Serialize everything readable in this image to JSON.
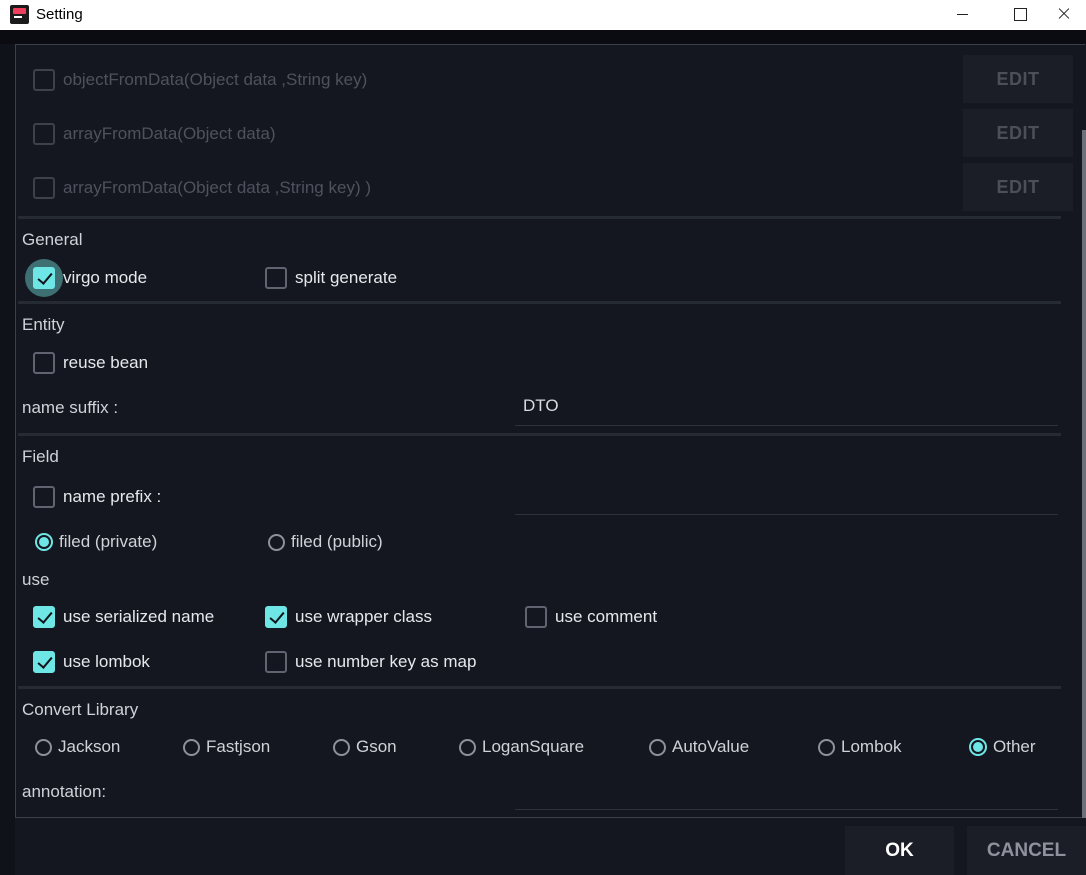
{
  "window": {
    "title": "Setting"
  },
  "methods": [
    {
      "label": "objectFromData(Object data ,String key)",
      "checked": false,
      "button": "EDIT"
    },
    {
      "label": "arrayFromData(Object data)",
      "checked": false,
      "button": "EDIT"
    },
    {
      "label": "arrayFromData(Object data ,String key) )",
      "checked": false,
      "button": "EDIT"
    }
  ],
  "general": {
    "title": "General",
    "virgo_mode": {
      "label": "virgo mode",
      "checked": true
    },
    "split_generate": {
      "label": "split generate",
      "checked": false
    }
  },
  "entity": {
    "title": "Entity",
    "reuse_bean": {
      "label": "reuse bean",
      "checked": false
    },
    "name_suffix_label": "name suffix :",
    "name_suffix_value": "DTO"
  },
  "field": {
    "title": "Field",
    "name_prefix": {
      "label": "name prefix :",
      "checked": false,
      "value": ""
    },
    "visibility_options": [
      {
        "label": "filed (private)",
        "selected": true
      },
      {
        "label": "filed (public)",
        "selected": false
      }
    ]
  },
  "use": {
    "title": "use",
    "options": [
      {
        "label": "use serialized name",
        "checked": true
      },
      {
        "label": "use wrapper class",
        "checked": true
      },
      {
        "label": "use comment",
        "checked": false
      },
      {
        "label": "use lombok",
        "checked": true
      },
      {
        "label": "use number key as map",
        "checked": false
      }
    ]
  },
  "convert_library": {
    "title": "Convert Library",
    "options": [
      {
        "label": "Jackson",
        "selected": false
      },
      {
        "label": "Fastjson",
        "selected": false
      },
      {
        "label": "Gson",
        "selected": false
      },
      {
        "label": "LoganSquare",
        "selected": false
      },
      {
        "label": "AutoValue",
        "selected": false
      },
      {
        "label": "Lombok",
        "selected": false
      },
      {
        "label": "Other",
        "selected": true
      }
    ],
    "annotation_label": "annotation:",
    "annotation_value": ""
  },
  "footer": {
    "ok": "OK",
    "cancel": "CANCEL"
  },
  "colors": {
    "accent": "#6fe6e6",
    "background": "#14171f",
    "button": "#1b1e26"
  }
}
